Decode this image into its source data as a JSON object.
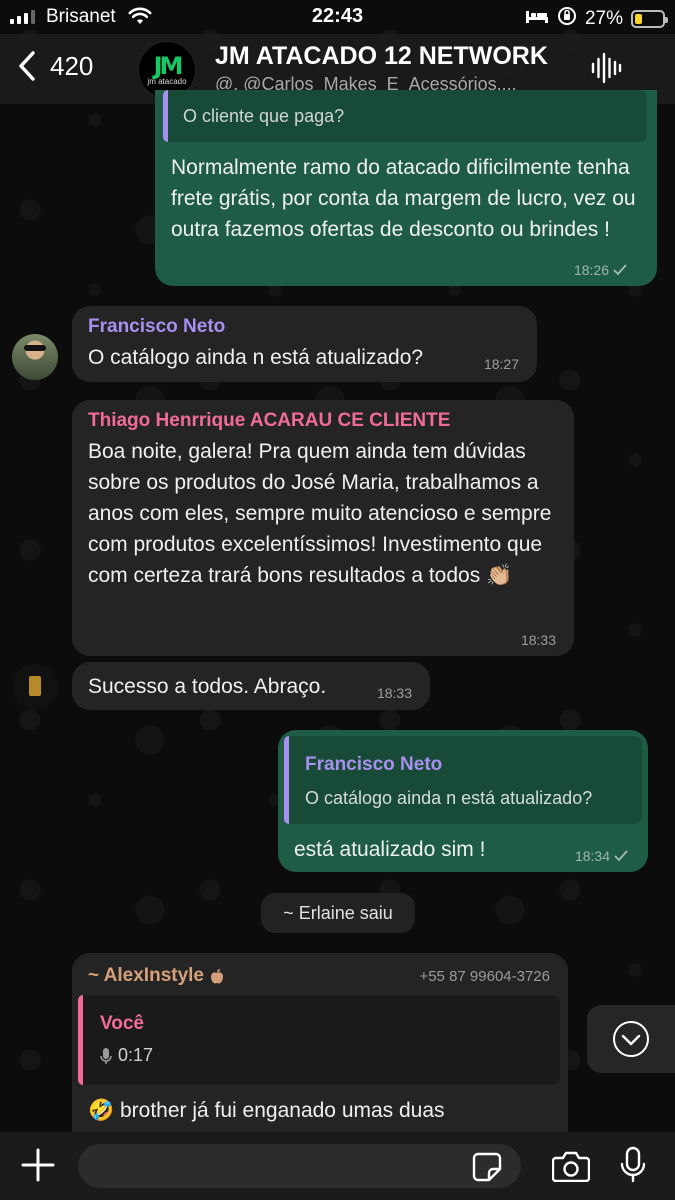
{
  "status_bar": {
    "carrier": "Brisanet",
    "time": "22:43",
    "battery_text": "27%",
    "battery_level": 0.27
  },
  "header": {
    "back_count": "420",
    "title": "JM ATACADO 12 NETWORK",
    "members": "@, @Carlos_Makes_E_Acessórios,...",
    "avatar_logo": "JM",
    "avatar_sub": "jm atacado"
  },
  "messages": [
    {
      "quote_text": "O cliente que paga?",
      "text": "Normalmente ramo do atacado dificilmente tenha frete grátis, por conta da margem de lucro, vez ou outra fazemos ofertas de desconto ou brindes !",
      "time": "18:26",
      "status_icon": "check-icon"
    },
    {
      "sender": "Francisco Neto",
      "sender_color": "#a98ff0",
      "text": "O catálogo ainda n está atualizado?",
      "time": "18:27"
    },
    {
      "sender": "Thiago Henrrique ACARAU CE CLIENTE",
      "sender_color": "#f06b9a",
      "text": "Boa noite, galera! Pra quem ainda tem dúvidas sobre os produtos do José Maria, trabalhamos a anos com eles, sempre muito atencioso e sempre com produtos excelentíssimos! Investimento que com certeza trará bons resultados a todos 👏🏼",
      "time": "18:33"
    },
    {
      "text": "Sucesso a todos. Abraço.",
      "time": "18:33"
    },
    {
      "quote_sender": "Francisco Neto",
      "quote_text": "O catálogo ainda n está atualizado?",
      "text": "está atualizado sim !",
      "time": "18:34",
      "status_icon": "check-icon"
    },
    {
      "sender": "~ AlexInstyle",
      "sender_color": "#d6a07a",
      "sender_phone": "+55 87 99604-3726",
      "quote_sender": "Você",
      "quote_sender_color": "#f06b9a",
      "quote_audio": "0:17",
      "text": "🤣 brother já fui enganado umas duas"
    }
  ],
  "system_message": "~ Erlaine saiu",
  "input": {
    "placeholder": ""
  },
  "colors": {
    "outgoing_bubble": "#1f5c45",
    "incoming_bubble": "#242424",
    "background": "#0c0c0c"
  }
}
